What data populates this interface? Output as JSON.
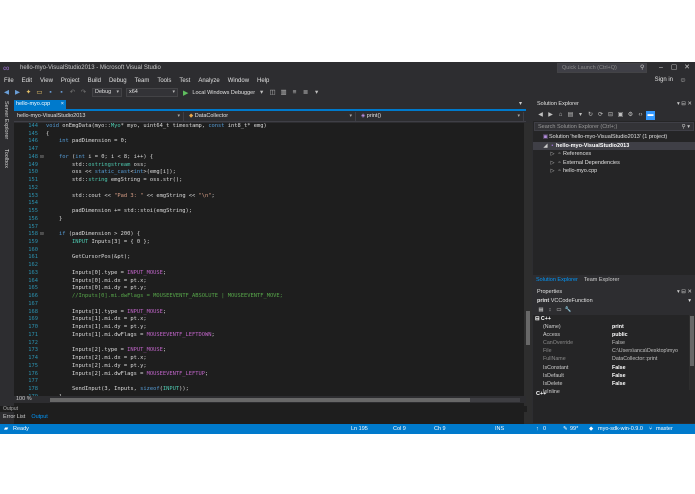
{
  "title": "hello-myo-VisualStudio2013 - Microsoft Visual Studio",
  "quick_launch": {
    "placeholder": "Quick Launch (Ctrl+Q)"
  },
  "menu": [
    "File",
    "Edit",
    "View",
    "Project",
    "Build",
    "Debug",
    "Team",
    "Tools",
    "Test",
    "Analyze",
    "Window",
    "Help"
  ],
  "sign_in": "Sign in",
  "toolbar": {
    "configuration": "Debug",
    "platform": "x64",
    "debugger": "Local Windows Debugger"
  },
  "side_tabs": [
    "Server Explorer",
    "Toolbox"
  ],
  "editor_tab": {
    "label": "hello-myo.cpp",
    "close": "×"
  },
  "nav": {
    "project": "hello-myo-VisualStudio2013",
    "scope": "DataCollector",
    "member": "print()"
  },
  "code_lines": [
    {
      "n": "144",
      "f": "",
      "h": "<span class=\"kw\">void</span> onEmgData(myo::<span class=\"typ\">Myo</span>* myo, uint64_t timestamp, <span class=\"kw\">const</span> int8_t* emg)"
    },
    {
      "n": "145",
      "f": "",
      "h": "{"
    },
    {
      "n": "146",
      "f": "",
      "h": "    <span class=\"kw\">int</span> padDimension = 0;"
    },
    {
      "n": "147",
      "f": "",
      "h": ""
    },
    {
      "n": "148",
      "f": "⊟",
      "h": "    <span class=\"kw\">for</span> (<span class=\"kw\">int</span> i = 0; i &lt; 8; i++) {"
    },
    {
      "n": "149",
      "f": "",
      "h": "        std::<span class=\"typ\">ostringstream</span> oss;"
    },
    {
      "n": "150",
      "f": "",
      "h": "        oss &lt;&lt; <span class=\"kw\">static_cast</span>&lt;<span class=\"kw\">int</span>&gt;(emg[i]);"
    },
    {
      "n": "151",
      "f": "",
      "h": "        std::<span class=\"typ\">string</span> emgString = oss.str();"
    },
    {
      "n": "152",
      "f": "",
      "h": ""
    },
    {
      "n": "153",
      "f": "",
      "h": "        std::cout &lt;&lt; <span class=\"str\">\"Pad 3: \"</span> &lt;&lt; emgString &lt;&lt; <span class=\"str\">\"\\n\"</span>;"
    },
    {
      "n": "154",
      "f": "",
      "h": ""
    },
    {
      "n": "155",
      "f": "",
      "h": "        padDimension += std::stoi(emgString);"
    },
    {
      "n": "156",
      "f": "",
      "h": "    }"
    },
    {
      "n": "157",
      "f": "",
      "h": ""
    },
    {
      "n": "158",
      "f": "⊟",
      "h": "    <span class=\"kw\">if</span> (padDimension &gt; 200) {"
    },
    {
      "n": "159",
      "f": "",
      "h": "        <span class=\"typ\">INPUT</span> Inputs[3] = { 0 };"
    },
    {
      "n": "160",
      "f": "",
      "h": ""
    },
    {
      "n": "161",
      "f": "",
      "h": "        GetCursorPos(&amp;pt);"
    },
    {
      "n": "162",
      "f": "",
      "h": ""
    },
    {
      "n": "163",
      "f": "",
      "h": "        Inputs[0].type = <span class=\"mac\">INPUT_MOUSE</span>;"
    },
    {
      "n": "164",
      "f": "",
      "h": "        Inputs[0].mi.dx = pt.x;"
    },
    {
      "n": "165",
      "f": "",
      "h": "        Inputs[0].mi.dy = pt.y;"
    },
    {
      "n": "166",
      "f": "",
      "h": "        <span class=\"cmt\">//Inputs[0].mi.dwFlags = MOUSEEVENTF_ABSOLUTE | MOUSEEVENTF_MOVE;</span>"
    },
    {
      "n": "167",
      "f": "",
      "h": ""
    },
    {
      "n": "168",
      "f": "",
      "h": "        Inputs[1].type = <span class=\"mac\">INPUT_MOUSE</span>;"
    },
    {
      "n": "169",
      "f": "",
      "h": "        Inputs[1].mi.dx = pt.x;"
    },
    {
      "n": "170",
      "f": "",
      "h": "        Inputs[1].mi.dy = pt.y;"
    },
    {
      "n": "171",
      "f": "",
      "h": "        Inputs[1].mi.dwFlags = <span class=\"mac\">MOUSEEVENTF_LEFTDOWN</span>;"
    },
    {
      "n": "172",
      "f": "",
      "h": ""
    },
    {
      "n": "173",
      "f": "",
      "h": "        Inputs[2].type = <span class=\"mac\">INPUT_MOUSE</span>;"
    },
    {
      "n": "174",
      "f": "",
      "h": "        Inputs[2].mi.dx = pt.x;"
    },
    {
      "n": "175",
      "f": "",
      "h": "        Inputs[2].mi.dy = pt.y;"
    },
    {
      "n": "176",
      "f": "",
      "h": "        Inputs[2].mi.dwFlags = <span class=\"mac\">MOUSEEVENTF_LEFTUP</span>;"
    },
    {
      "n": "177",
      "f": "",
      "h": ""
    },
    {
      "n": "178",
      "f": "",
      "h": "        SendInput(3, Inputs, <span class=\"kw\">sizeof</span>(<span class=\"typ\">INPUT</span>));"
    },
    {
      "n": "179",
      "f": "",
      "h": "    }"
    }
  ],
  "zoom": "100 %",
  "output_header": "Output",
  "bottom_tabs": [
    "Error List",
    "Output"
  ],
  "solution_explorer": {
    "title": "Solution Explorer",
    "search_placeholder": "Search Solution Explorer (Ctrl+;)",
    "tree": [
      {
        "depth": 0,
        "tw": "",
        "icon": "▣",
        "label": "Solution 'hello-myo-VisualStudio2013' (1 project)",
        "sel": false
      },
      {
        "depth": 1,
        "tw": "◢",
        "icon": "▪",
        "label": "hello-myo-VisualStudio2013",
        "sel": true
      },
      {
        "depth": 2,
        "tw": "▷",
        "icon": "▫",
        "label": "References",
        "sel": false
      },
      {
        "depth": 2,
        "tw": "▷",
        "icon": "▫",
        "label": "External Dependencies",
        "sel": false
      },
      {
        "depth": 2,
        "tw": "▷",
        "icon": "▫",
        "label": "hello-myo.cpp",
        "sel": false
      }
    ],
    "tabs": [
      "Solution Explorer",
      "Team Explorer"
    ]
  },
  "properties": {
    "title": "Properties",
    "object_name": "print",
    "object_type": "VCCodeFunction",
    "category": "C++",
    "rows": [
      {
        "k": "(Name)",
        "v": "print",
        "dim": false
      },
      {
        "k": "Access",
        "v": "public",
        "dim": false
      },
      {
        "k": "CanOverride",
        "v": "False",
        "dim": true
      },
      {
        "k": "File",
        "v": "C:\\Users\\anca\\Desktop\\myo",
        "dim": true
      },
      {
        "k": "FullName",
        "v": "DataCollector::print",
        "dim": true
      },
      {
        "k": "IsConstant",
        "v": "False",
        "dim": false
      },
      {
        "k": "IsDefault",
        "v": "False",
        "dim": false
      },
      {
        "k": "IsDelete",
        "v": "False",
        "dim": false
      },
      {
        "k": "IsInline",
        "v": "",
        "dim": false
      }
    ],
    "footer_category": "C++"
  },
  "status": {
    "ready": "Ready",
    "ln": "Ln 195",
    "col": "Col 9",
    "ch": "Ch 9",
    "ins": "INS",
    "up": "0",
    "pencil": "99*",
    "branch": "myo-sdk-win-0.9.0",
    "master": "master"
  }
}
